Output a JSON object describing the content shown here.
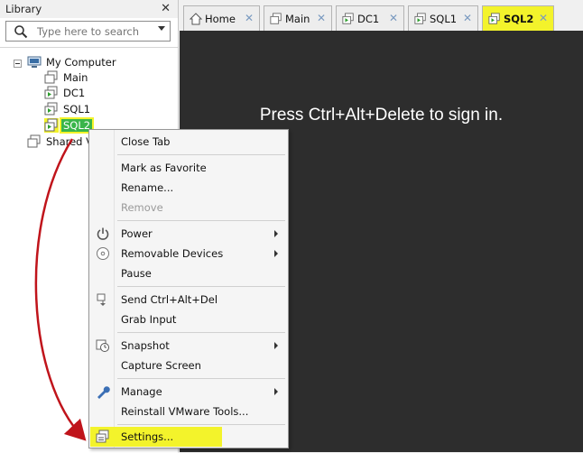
{
  "library": {
    "title": "Library",
    "close_glyph": "✕",
    "search_placeholder": "Type here to search",
    "tree": {
      "root": "My Computer",
      "children": [
        "Main",
        "DC1",
        "SQL1",
        "SQL2"
      ],
      "shared": "Shared V",
      "selected": "SQL2"
    }
  },
  "tabs": [
    {
      "label": "Home",
      "icon": "home-icon"
    },
    {
      "label": "Main",
      "icon": "vm-icon"
    },
    {
      "label": "DC1",
      "icon": "vm-running-icon"
    },
    {
      "label": "SQL1",
      "icon": "vm-running-icon"
    },
    {
      "label": "SQL2",
      "icon": "vm-running-icon",
      "active": true
    }
  ],
  "tab_close_glyph": "✕",
  "console": {
    "message": "Press Ctrl+Alt+Delete to sign in."
  },
  "context_menu": {
    "items": [
      {
        "label": "Close Tab"
      },
      {
        "label": "Mark as Favorite"
      },
      {
        "label": "Rename..."
      },
      {
        "label": "Remove",
        "disabled": true
      },
      {
        "label": "Power",
        "icon": "power-icon",
        "submenu": true
      },
      {
        "label": "Removable Devices",
        "icon": "cd-icon",
        "submenu": true
      },
      {
        "label": "Pause"
      },
      {
        "label": "Send Ctrl+Alt+Del",
        "icon": "keyboard-icon"
      },
      {
        "label": "Grab Input"
      },
      {
        "label": "Snapshot",
        "icon": "snapshot-icon",
        "submenu": true
      },
      {
        "label": "Capture Screen"
      },
      {
        "label": "Manage",
        "icon": "wrench-icon",
        "submenu": true
      },
      {
        "label": "Reinstall VMware Tools..."
      },
      {
        "label": "Settings...",
        "icon": "settings-icon",
        "highlighted": true
      }
    ]
  },
  "colors": {
    "highlight_yellow": "#f3f32b",
    "selected_green": "#39b54a",
    "console_bg": "#2d2d2d",
    "annotation_arrow": "#c0141b"
  }
}
